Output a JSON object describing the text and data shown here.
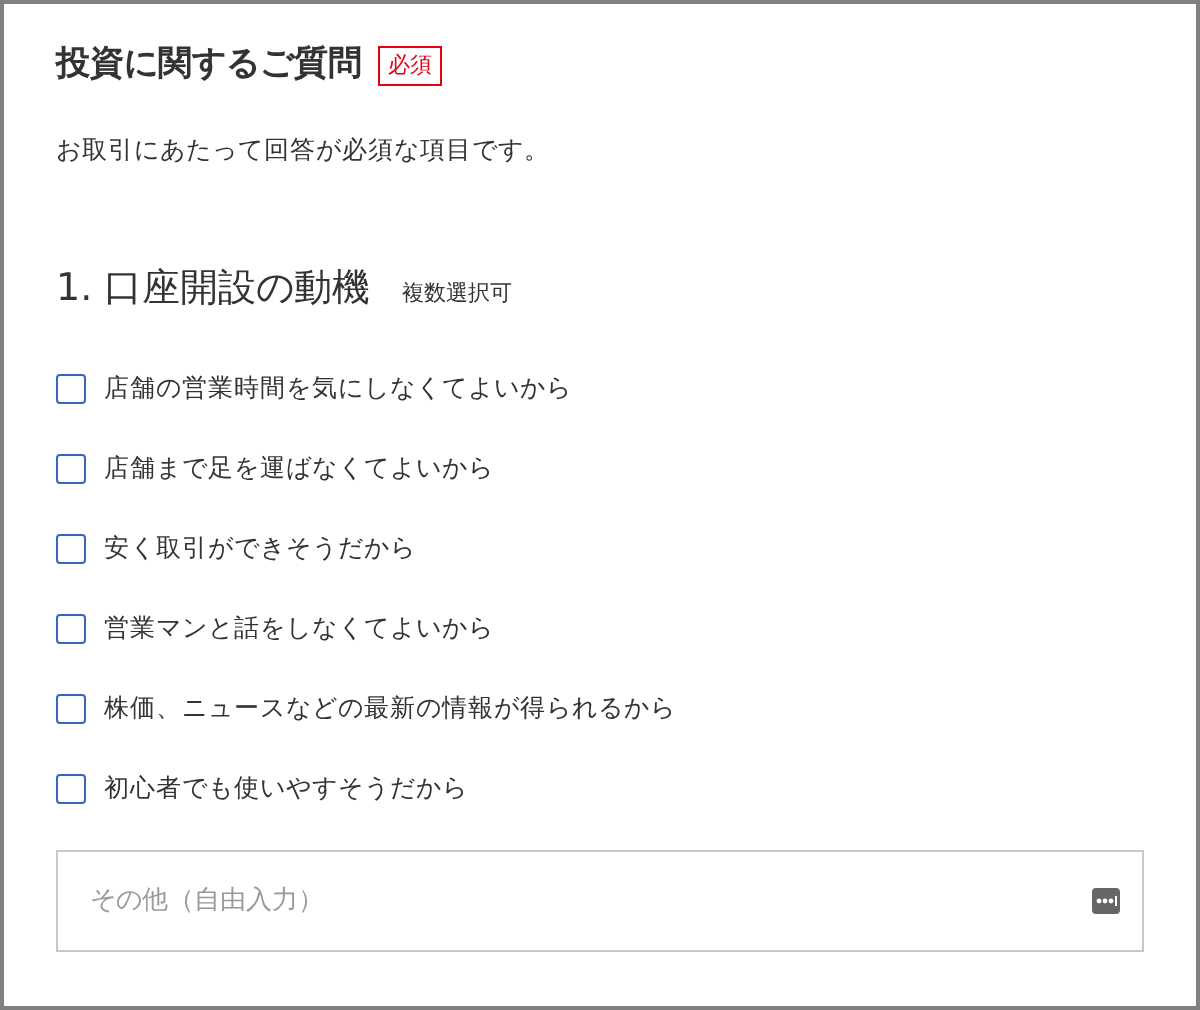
{
  "section": {
    "title": "投資に関するご質問",
    "badge": "必須",
    "description": "お取引にあたって回答が必須な項目です。"
  },
  "question": {
    "number": "1.",
    "title": "口座開設の動機",
    "note": "複数選択可",
    "options": [
      {
        "label": "店舗の営業時間を気にしなくてよいから",
        "checked": false
      },
      {
        "label": "店舗まで足を運ばなくてよいから",
        "checked": false
      },
      {
        "label": "安く取引ができそうだから",
        "checked": false
      },
      {
        "label": "営業マンと話をしなくてよいから",
        "checked": false
      },
      {
        "label": "株価、ニュースなどの最新の情報が得られるから",
        "checked": false
      },
      {
        "label": "初心者でも使いやすそうだから",
        "checked": false
      }
    ],
    "other": {
      "placeholder": "その他（自由入力）"
    }
  }
}
